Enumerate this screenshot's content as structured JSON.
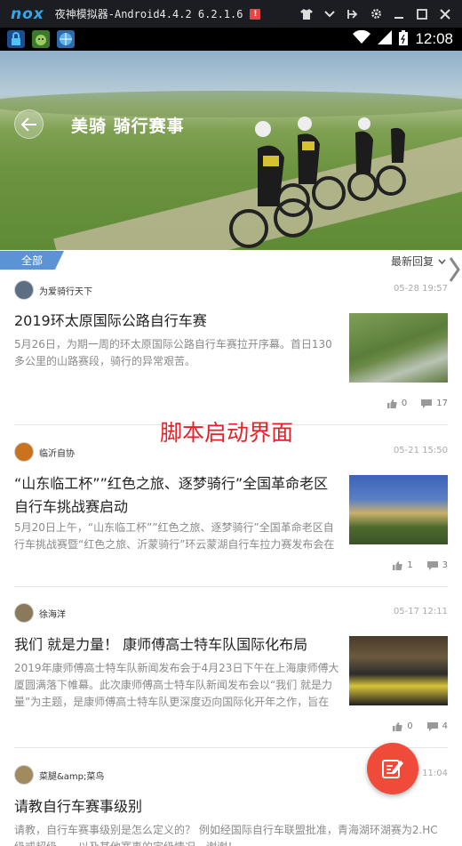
{
  "emulator": {
    "logo": "nox",
    "title": "夜神模拟器-Android4.4.2 6.2.1.6",
    "badge": "!"
  },
  "status_bar": {
    "time": "12:08"
  },
  "header": {
    "title": "美骑 骑行赛事"
  },
  "filter": {
    "all_label": "全部",
    "sort_label": "最新回复"
  },
  "overlay_text": "脚本启动界面",
  "posts": [
    {
      "author": "为爱骑行天下",
      "date": "05-28 19:57",
      "title": "2019环太原国际公路自行车赛",
      "excerpt": "5月26日，为期一周的环太原国际公路自行车赛拉开序幕。首日130多公里的山路赛段，骑行的异常艰苦。",
      "likes": "0",
      "comments": "17"
    },
    {
      "author": "临沂自协",
      "date": "05-21 15:50",
      "title": "“山东临工杯””红色之旅、逐梦骑行”全国革命老区自行车挑战赛启动",
      "excerpt": "5月20日上午，“山东临工杯””红色之旅、逐梦骑行”全国革命老区自行车挑战赛暨“红色之旅、沂蒙骑行”环云蒙湖自行车拉力赛发布会在临沂",
      "likes": "1",
      "comments": "3"
    },
    {
      "author": "徐海洋",
      "date": "05-17 12:11",
      "title": "我们 就是力量！ 康师傅高士特车队国际化布局",
      "excerpt": "2019年康师傅高士特车队新闻发布会于4月23日下午在上海康师傅大厦圆满落下帷幕。此次康师傅高士特车队新闻发布会以“我们 就是力量”为主题，是康师傅高士特车队更深度迈向国际化开年之作，旨在引领跨界",
      "likes": "0",
      "comments": "4"
    },
    {
      "author": "菜腿&amp;菜鸟",
      "date": "4 11:04",
      "title": "请教自行车赛事级别",
      "excerpt": "请教，自行车赛事级别是怎么定义的？ 例如经国际自行车联盟批准，青海湖环湖赛为2.HC级或超级，一以及其他赛事的定级情况。谢谢！"
    }
  ],
  "colors": {
    "accent_blue": "#5b93d4",
    "fab_red": "#ef4a3a",
    "overlay_red": "#e8202a"
  }
}
